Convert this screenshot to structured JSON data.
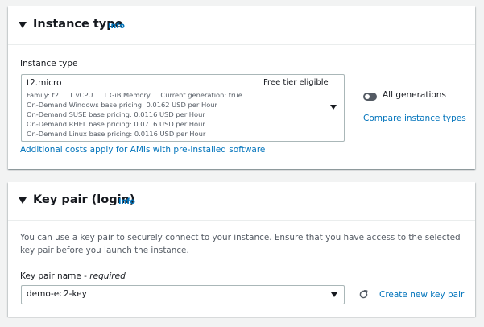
{
  "instance_type_panel": {
    "title": "Instance type",
    "info": "Info",
    "field_label": "Instance type",
    "selected": {
      "name": "t2.micro",
      "badge": "Free tier eligible",
      "family": "Family: t2",
      "vcpu": "1 vCPU",
      "memory": "1 GiB Memory",
      "generation": "Current generation: true",
      "pricing": [
        "On-Demand Windows base pricing: 0.0162 USD per Hour",
        "On-Demand SUSE base pricing: 0.0116 USD per Hour",
        "On-Demand RHEL base pricing: 0.0716 USD per Hour",
        "On-Demand Linux base pricing: 0.0116 USD per Hour"
      ]
    },
    "all_generations_label": "All generations",
    "all_generations_on": false,
    "compare_link": "Compare instance types",
    "additional_costs_link": "Additional costs apply for AMIs with pre-installed software"
  },
  "key_pair_panel": {
    "title": "Key pair (login)",
    "info": "Info",
    "description": "You can use a key pair to securely connect to your instance. Ensure that you have access to the selected key pair before you launch the instance.",
    "field_label": "Key pair name - ",
    "field_required": "required",
    "selected": "demo-ec2-key",
    "create_link": "Create new key pair"
  },
  "colors": {
    "link": "#0073bb",
    "background": "#f2f3f3",
    "muted_text": "#545b64"
  },
  "icons": {
    "collapse": "caret-down-icon",
    "dropdown": "chevron-down-icon",
    "refresh": "refresh-icon"
  }
}
